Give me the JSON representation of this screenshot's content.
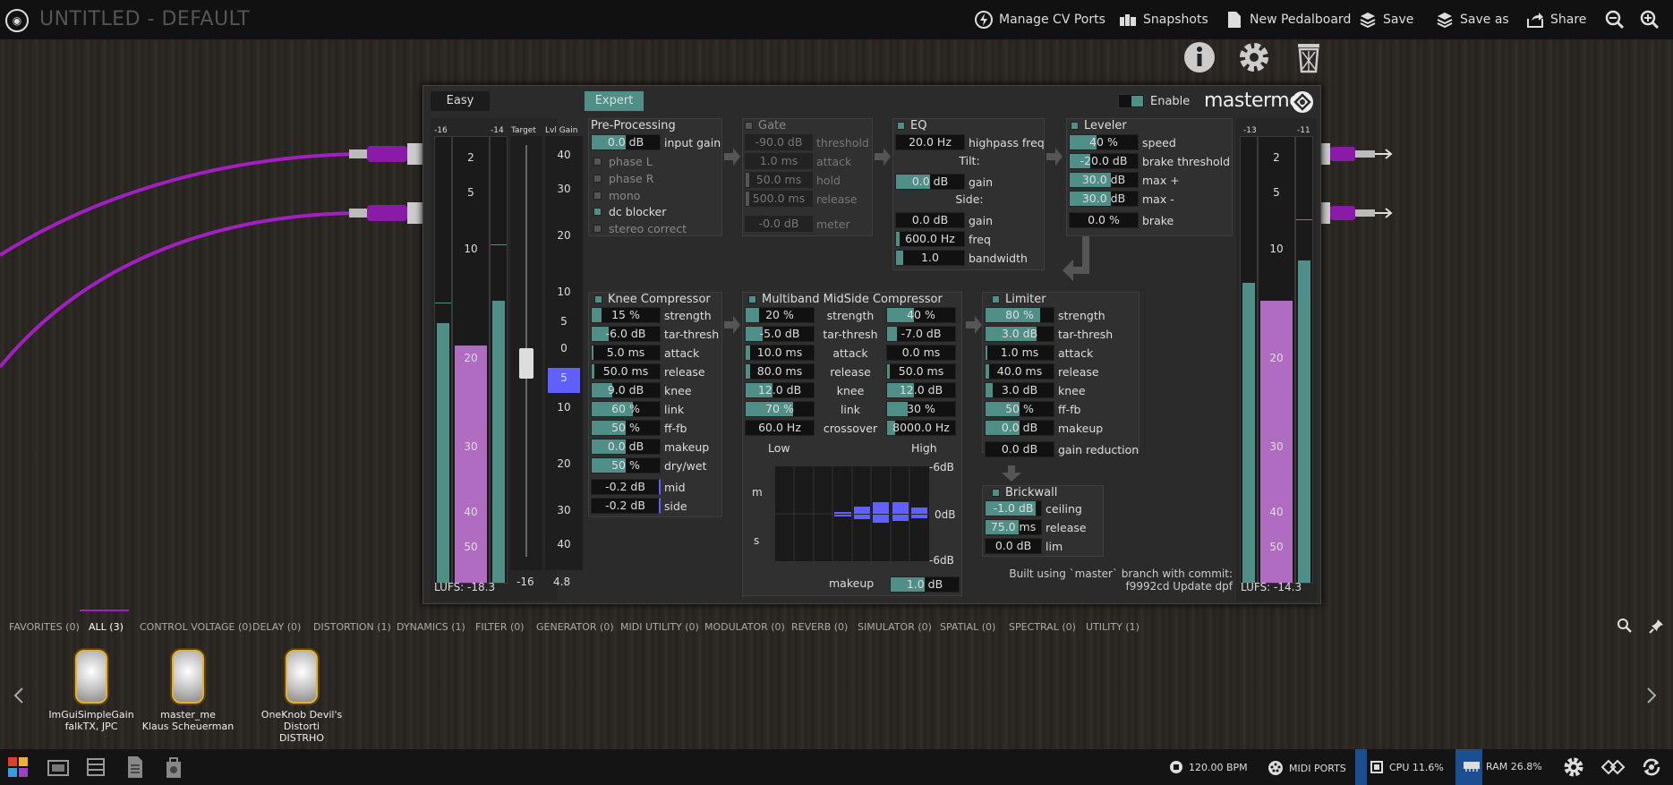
{
  "topbar": {
    "title": "UNTITLED - DEFAULT",
    "buttons": [
      "Manage CV Ports",
      "Snapshots",
      "New Pedalboard",
      "Save",
      "Save as",
      "Share"
    ]
  },
  "plugin": {
    "mode_easy": "Easy",
    "mode_expert": "Expert",
    "enable": "Enable",
    "brand": "masterme",
    "left_meter": {
      "top_labels": [
        "-16",
        "-14"
      ],
      "target": "Target",
      "lvl_gain": "Lvl Gain",
      "scale": [
        "2",
        "5",
        "10",
        "20",
        "30",
        "40",
        "50"
      ],
      "gain_scale": [
        "40",
        "30",
        "20",
        "10",
        "5",
        "0",
        "5",
        "10",
        "20",
        "30",
        "40"
      ],
      "lufs": "LUFS: -18.3",
      "target_val": "-16",
      "gain_val": "4.8"
    },
    "right_meter": {
      "top_labels": [
        "-13",
        "-11"
      ],
      "scale": [
        "2",
        "5",
        "10",
        "20",
        "30",
        "40",
        "50"
      ],
      "lufs": "LUFS: -14.3"
    },
    "pre": {
      "title": "Pre-Processing",
      "input_gain": "0.0 dB",
      "input_gain_label": "input gain",
      "checks": [
        "phase L",
        "phase R",
        "mono",
        "dc blocker",
        "stereo correct"
      ]
    },
    "gate": {
      "title": "Gate",
      "rows": [
        {
          "v": "-90.0 dB",
          "l": "threshold"
        },
        {
          "v": "1.0 ms",
          "l": "attack"
        },
        {
          "v": "50.0 ms",
          "l": "hold"
        },
        {
          "v": "500.0 ms",
          "l": "release"
        }
      ],
      "meter": {
        "v": "-0.0 dB",
        "l": "meter"
      }
    },
    "eq": {
      "title": "EQ",
      "highpass": {
        "v": "20.0 Hz",
        "l": "highpass freq"
      },
      "tilt": "Tilt:",
      "tilt_gain": {
        "v": "0.0 dB",
        "l": "gain"
      },
      "side": "Side:",
      "side_rows": [
        {
          "v": "0.0 dB",
          "l": "gain"
        },
        {
          "v": "600.0 Hz",
          "l": "freq"
        },
        {
          "v": "1.0",
          "l": "bandwidth"
        }
      ]
    },
    "leveler": {
      "title": "Leveler",
      "rows": [
        {
          "v": "40 %",
          "l": "speed"
        },
        {
          "v": "-20.0 dB",
          "l": "brake threshold"
        },
        {
          "v": "30.0 dB",
          "l": "max +"
        },
        {
          "v": "30.0 dB",
          "l": "max -"
        }
      ],
      "brake": {
        "v": "0.0 %",
        "l": "brake"
      }
    },
    "knee": {
      "title": "Knee Compressor",
      "rows": [
        {
          "v": "15 %",
          "l": "strength"
        },
        {
          "v": "-6.0 dB",
          "l": "tar-thresh"
        },
        {
          "v": "5.0 ms",
          "l": "attack"
        },
        {
          "v": "50.0 ms",
          "l": "release"
        },
        {
          "v": "9.0 dB",
          "l": "knee"
        },
        {
          "v": "60 %",
          "l": "link"
        },
        {
          "v": "50 %",
          "l": "ff-fb"
        },
        {
          "v": "0.0 dB",
          "l": "makeup"
        },
        {
          "v": "50 %",
          "l": "dry/wet"
        }
      ],
      "mid": {
        "v": "-0.2 dB",
        "l": "mid"
      },
      "side": {
        "v": "-0.2 dB",
        "l": "side"
      }
    },
    "multiband": {
      "title": "Multiband MidSide Compressor",
      "rows": [
        {
          "low": "20 %",
          "l": "strength",
          "high": "40 %"
        },
        {
          "low": "-5.0 dB",
          "l": "tar-thresh",
          "high": "-7.0 dB"
        },
        {
          "low": "10.0 ms",
          "l": "attack",
          "high": "0.0 ms"
        },
        {
          "low": "80.0 ms",
          "l": "release",
          "high": "50.0 ms"
        },
        {
          "low": "12.0 dB",
          "l": "knee",
          "high": "12.0 dB"
        },
        {
          "low": "70 %",
          "l": "link",
          "high": "30 %"
        },
        {
          "low": "60.0 Hz",
          "l": "crossover",
          "high": "8000.0 Hz"
        }
      ],
      "low": "Low",
      "high": "High",
      "m": "m",
      "s": "s",
      "db_top": "-6dB",
      "db_mid": "0dB",
      "db_bot": "-6dB",
      "makeup": {
        "l": "makeup",
        "v": "1.0 dB"
      }
    },
    "limiter": {
      "title": "Limiter",
      "rows": [
        {
          "v": "80 %",
          "l": "strength"
        },
        {
          "v": "3.0 dB",
          "l": "tar-thresh"
        },
        {
          "v": "1.0 ms",
          "l": "attack"
        },
        {
          "v": "40.0 ms",
          "l": "release"
        },
        {
          "v": "3.0 dB",
          "l": "knee"
        },
        {
          "v": "50 %",
          "l": "ff-fb"
        },
        {
          "v": "0.0 dB",
          "l": "makeup"
        }
      ],
      "gr": {
        "v": "0.0 dB",
        "l": "gain reduction"
      }
    },
    "brickwall": {
      "title": "Brickwall",
      "rows": [
        {
          "v": "-1.0 dB",
          "l": "ceiling"
        },
        {
          "v": "75.0 ms",
          "l": "release"
        },
        {
          "v": "0.0 dB",
          "l": "lim"
        }
      ]
    },
    "build": [
      "Built using `master` branch with commit:",
      "f9992cd Update dpf"
    ]
  },
  "categories": [
    "FAVORITES (0)",
    "ALL (3)",
    "CONTROL VOLTAGE (0)",
    "DELAY (0)",
    "DISTORTION (1)",
    "DYNAMICS (1)",
    "FILTER (0)",
    "GENERATOR (0)",
    "MIDI UTILITY (0)",
    "MODULATOR (0)",
    "REVERB (0)",
    "SIMULATOR (0)",
    "SPATIAL (0)",
    "SPECTRAL (0)",
    "UTILITY (1)"
  ],
  "pedals": [
    {
      "name": "ImGuiSimpleGain",
      "author": "falkTX, JPC"
    },
    {
      "name": "master_me",
      "author": "Klaus Scheuerman"
    },
    {
      "name": "OneKnob Devil's Distorti",
      "author": "DISTRHO"
    }
  ],
  "status": {
    "bpm": "120.00 BPM",
    "midi": "MIDI PORTS",
    "cpu": "CPU 11.6%",
    "ram": "RAM 26.8%"
  }
}
